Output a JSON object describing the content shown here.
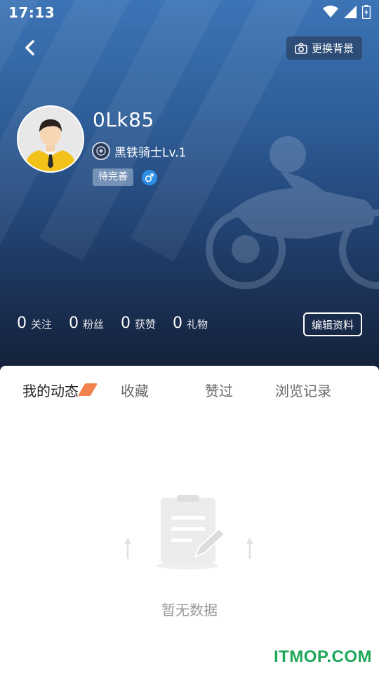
{
  "status_bar": {
    "time": "17:13",
    "icons": [
      "wifi-icon",
      "signal-icon",
      "battery-icon"
    ]
  },
  "header": {
    "back_icon": "chevron-left-icon",
    "change_background_label": "更换背景",
    "change_background_icon": "camera-icon"
  },
  "profile": {
    "username": "0Lk85",
    "level_text": "黑铁骑士Lv.1",
    "tag": "待完善",
    "gender": "male"
  },
  "stats": [
    {
      "value": "0",
      "label": "关注"
    },
    {
      "value": "0",
      "label": "粉丝"
    },
    {
      "value": "0",
      "label": "获赞"
    },
    {
      "value": "0",
      "label": "礼物"
    }
  ],
  "edit_profile_label": "编辑资料",
  "tabs": [
    {
      "label": "我的动态",
      "active": true
    },
    {
      "label": "收藏",
      "active": false
    },
    {
      "label": "赞过",
      "active": false
    },
    {
      "label": "浏览记录",
      "active": false
    }
  ],
  "empty_state": {
    "text": "暂无数据",
    "icon": "empty-document-icon"
  },
  "watermark": "ITMOP.COM",
  "colors": {
    "header_top": "#3d74b6",
    "header_bottom": "#131f36",
    "accent_orange": "#f2834c",
    "gender_blue": "#2e8fe6",
    "watermark_green": "#1fa85a"
  }
}
